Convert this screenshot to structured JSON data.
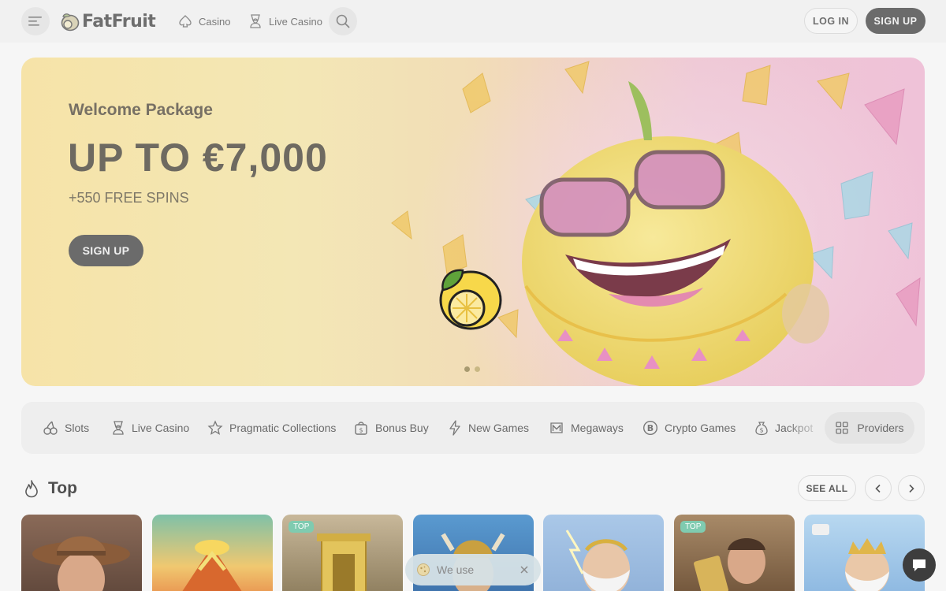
{
  "header": {
    "logo_text": "FatFruit",
    "nav": [
      {
        "label": "Casino",
        "icon": "spade-icon"
      },
      {
        "label": "Live Casino",
        "icon": "dealer-icon"
      }
    ],
    "login_label": "LOG IN",
    "signup_label": "SIGN UP"
  },
  "hero": {
    "subtitle": "Welcome Package",
    "title": "UP TO €7,000",
    "spins": "+550 FREE SPINS",
    "button_label": "SIGN UP",
    "slides": 2,
    "active_slide": 1
  },
  "categories": [
    {
      "label": "Slots",
      "icon": "cherries-icon"
    },
    {
      "label": "Live Casino",
      "icon": "dealer-icon"
    },
    {
      "label": "Pragmatic Collections",
      "icon": "star-icon"
    },
    {
      "label": "Bonus Buy",
      "icon": "bag-icon"
    },
    {
      "label": "New Games",
      "icon": "lightning-icon"
    },
    {
      "label": "Megaways",
      "icon": "m-icon"
    },
    {
      "label": "Crypto Games",
      "icon": "bitcoin-icon"
    },
    {
      "label": "Jackpot",
      "icon": "moneybag-icon"
    }
  ],
  "providers_label": "Providers",
  "top_section": {
    "title": "Top",
    "see_all_label": "SEE ALL",
    "tiles": [
      {
        "badge": ""
      },
      {
        "badge": ""
      },
      {
        "badge": "TOP"
      },
      {
        "badge": ""
      },
      {
        "badge": ""
      },
      {
        "badge": "TOP"
      },
      {
        "badge": ""
      }
    ]
  },
  "cookie": {
    "text": "We use"
  },
  "colors": {
    "accent_dark": "#6b6b6b",
    "badge": "#7fcbb0",
    "hero_left": "#f6e3a8",
    "hero_right": "#efc2d8"
  }
}
